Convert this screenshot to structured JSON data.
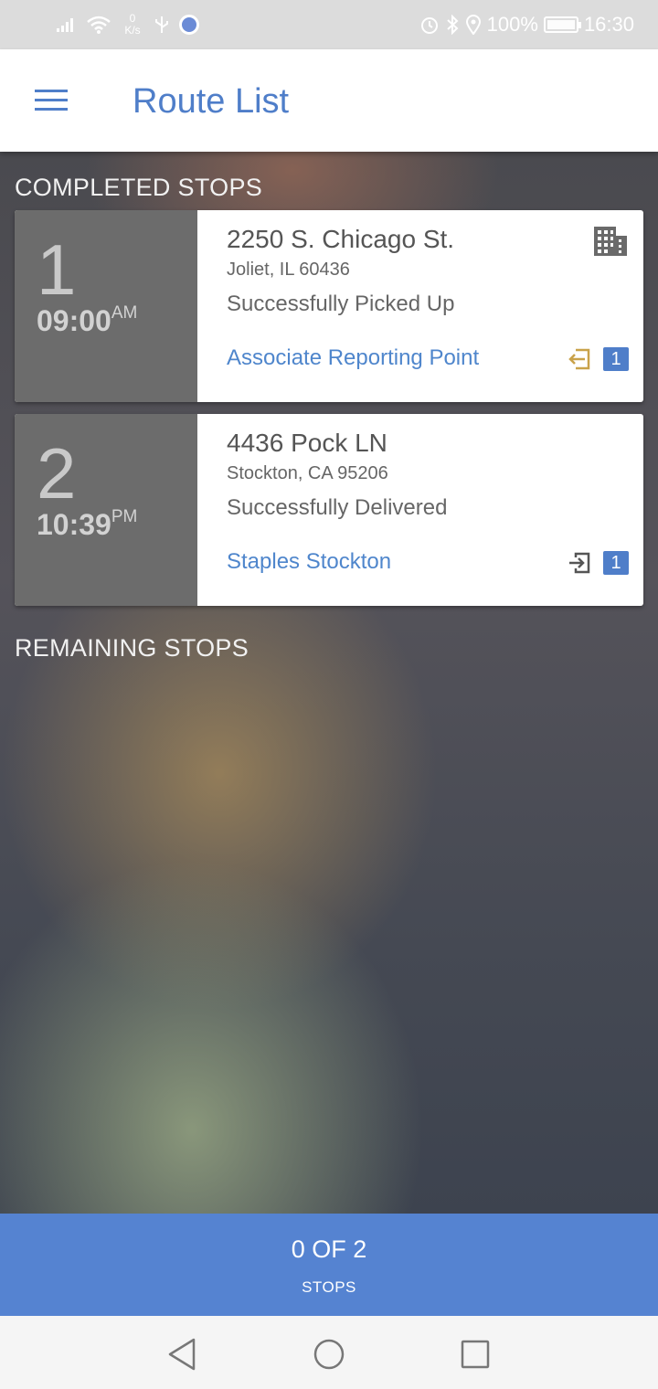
{
  "status_bar": {
    "net_speed": "0",
    "net_unit": "K/s",
    "battery": "100%",
    "time": "16:30"
  },
  "app_bar": {
    "title": "Route List"
  },
  "sections": {
    "completed_title": "COMPLETED STOPS",
    "remaining_title": "REMAINING STOPS"
  },
  "stops": [
    {
      "number": "1",
      "time": "09:00",
      "ampm": "AM",
      "address": "2250 S. Chicago St.",
      "city": "Joliet, IL 60436",
      "status": "Successfully Picked Up",
      "link": "Associate Reporting Point",
      "count": "1",
      "icon": "arrow-in-left-icon",
      "icon_color": "#c9a24a"
    },
    {
      "number": "2",
      "time": "10:39",
      "ampm": "PM",
      "address": "4436 Pock LN",
      "city": "Stockton, CA 95206",
      "status": "Successfully Delivered",
      "link": "Staples Stockton",
      "count": "1",
      "icon": "arrow-in-right-icon",
      "icon_color": "#555555"
    }
  ],
  "footer": {
    "count": "0 OF 2",
    "label": "STOPS"
  },
  "colors": {
    "accent": "#4f7ec9",
    "footer": "#5583d1"
  }
}
